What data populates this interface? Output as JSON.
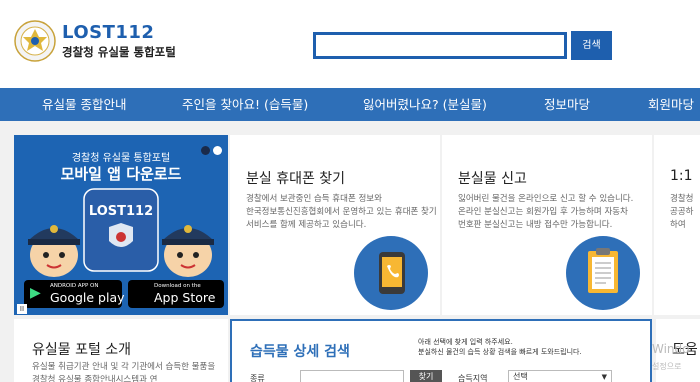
{
  "header": {
    "logo_title": "LOST112",
    "logo_subtitle": "경찰청 유실물 통합포털",
    "search_value": "",
    "search_button": "검색"
  },
  "nav": {
    "items": [
      "유실물 종합안내",
      "주인을 찾아요! (습득물)",
      "잃어버렸나요? (분실물)",
      "정보마당",
      "회원마당"
    ]
  },
  "banner": {
    "subtitle": "경찰청 유실물 통합포털",
    "title": "모바일 앱 다운로드",
    "badge": "LOST112",
    "google_small": "ANDROID APP ON",
    "google_big": "Google play",
    "apple_small": "Download on the",
    "apple_big": "App Store",
    "pause": "II"
  },
  "cards": [
    {
      "title": "분실 휴대폰 찾기",
      "desc": "경찰에서 보관중인 습득 휴대폰 정보와 한국정보통신진흥협회에서 운영하고 있는 휴대폰 찾기 서비스를 함께 제공하고 있습니다.",
      "icon": "phone-icon"
    },
    {
      "title": "분실물 신고",
      "desc": "잃어버린 물건을 온라인으로 신고 할 수 있습니다. 온라인 분실신고는 회원가입 후 가능하며 자동차 번호판 분실신고는 내방 접수만 가능합니다.",
      "icon": "document-icon"
    },
    {
      "title": "1:1 ",
      "desc": "경찰청 공공하 하여",
      "icon": ""
    }
  ],
  "intro": {
    "title": "유실물 포털 소개",
    "desc": "유실물 취급기관 안내 및 각 기관에서 습득한 물품을 경찰청 유실물 종합안내시스템과 연"
  },
  "detail_search": {
    "title": "습득물 상세 검색",
    "note_line1": "아래 선택에 찾게 입력 하주세요.",
    "note_line2": "분실하신 물건의 습득 상황 검색을 빠르게 도와드립니다.",
    "kind_label": "종류",
    "find_button": "찾기",
    "region_label": "습득지역",
    "region_value": "선택"
  },
  "right_section": {
    "title": "도움"
  },
  "os_watermark": {
    "line1": "Windo",
    "line2": "설정으로"
  },
  "colors": {
    "brand": "#1e5fae",
    "nav": "#2e6fb8",
    "banner": "#1d64b3",
    "background": "#f1f1f1"
  }
}
